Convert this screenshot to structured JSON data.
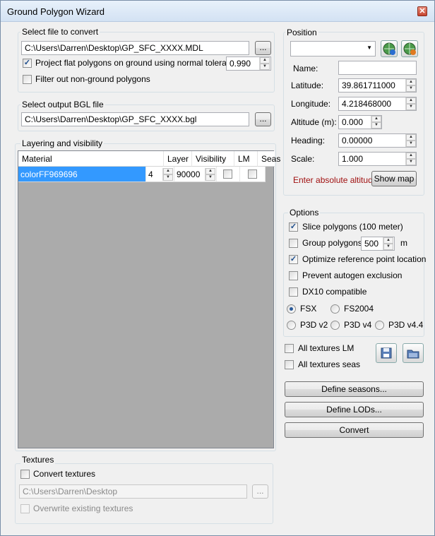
{
  "window": {
    "title": "Ground Polygon Wizard",
    "close_glyph": "✕"
  },
  "file_group": {
    "label": "Select file to convert",
    "path": "C:\\Users\\Darren\\Desktop\\GP_SFC_XXXX.MDL",
    "browse_label": "...",
    "project_label": "Project flat polygons on ground using normal tolerance:",
    "project_checked": true,
    "tolerance": "0.990",
    "filter_label": "Filter out non-ground polygons",
    "filter_checked": false
  },
  "output_group": {
    "label": "Select output BGL file",
    "path": "C:\\Users\\Darren\\Desktop\\GP_SFC_XXXX.bgl",
    "browse_label": "..."
  },
  "layering": {
    "label": "Layering and visibility",
    "headers": {
      "material": "Material",
      "layer": "Layer",
      "visibility": "Visibility",
      "lm": "LM",
      "seas": "Seas"
    },
    "rows": [
      {
        "material": "colorFF969696",
        "layer": "4",
        "visibility": "90000",
        "lm": false,
        "seas": false
      }
    ],
    "selected_color": "#3399ff"
  },
  "textures": {
    "label": "Textures",
    "convert_label": "Convert textures",
    "convert_checked": false,
    "path": "C:\\Users\\Darren\\Desktop",
    "browse_label": "...",
    "overwrite_label": "Overwrite existing textures",
    "overwrite_checked": false
  },
  "position": {
    "label": "Position",
    "dropdown_value": "",
    "name_label": "Name:",
    "name_value": "",
    "latitude_label": "Latitude:",
    "latitude_value": "39.861711000",
    "longitude_label": "Longitude:",
    "longitude_value": "4.218468000",
    "altitude_label": "Altitude (m):",
    "altitude_value": "0.000",
    "heading_label": "Heading:",
    "heading_value": "0.00000",
    "scale_label": "Scale:",
    "scale_value": "1.000",
    "warning": "Enter absolute altitude!",
    "show_map_label": "Show map",
    "warning_color": "#a01010"
  },
  "options": {
    "label": "Options",
    "slice_label": "Slice polygons (100 meter)",
    "slice_checked": true,
    "group_label": "Group polygons",
    "group_checked": false,
    "group_value": "500",
    "group_unit": "m",
    "optimize_label": "Optimize reference point location",
    "optimize_checked": true,
    "prevent_label": "Prevent autogen exclusion",
    "prevent_checked": false,
    "dx10_label": "DX10 compatible",
    "dx10_checked": false,
    "sims": [
      {
        "label": "FSX",
        "selected": true
      },
      {
        "label": "FS2004",
        "selected": false
      },
      {
        "label": "P3D v2",
        "selected": false
      },
      {
        "label": "P3D v4",
        "selected": false
      },
      {
        "label": "P3D v4.4",
        "selected": false
      }
    ]
  },
  "misc": {
    "all_lm_label": "All textures LM",
    "all_lm_checked": false,
    "all_seas_label": "All textures seas",
    "all_seas_checked": false
  },
  "buttons": {
    "define_seasons": "Define seasons...",
    "define_lods": "Define LODs...",
    "convert": "Convert"
  },
  "icons": {
    "globe_add": "globe-add-icon",
    "globe_refresh": "globe-refresh-icon",
    "save": "save-icon",
    "open_folder": "open-folder-icon"
  }
}
